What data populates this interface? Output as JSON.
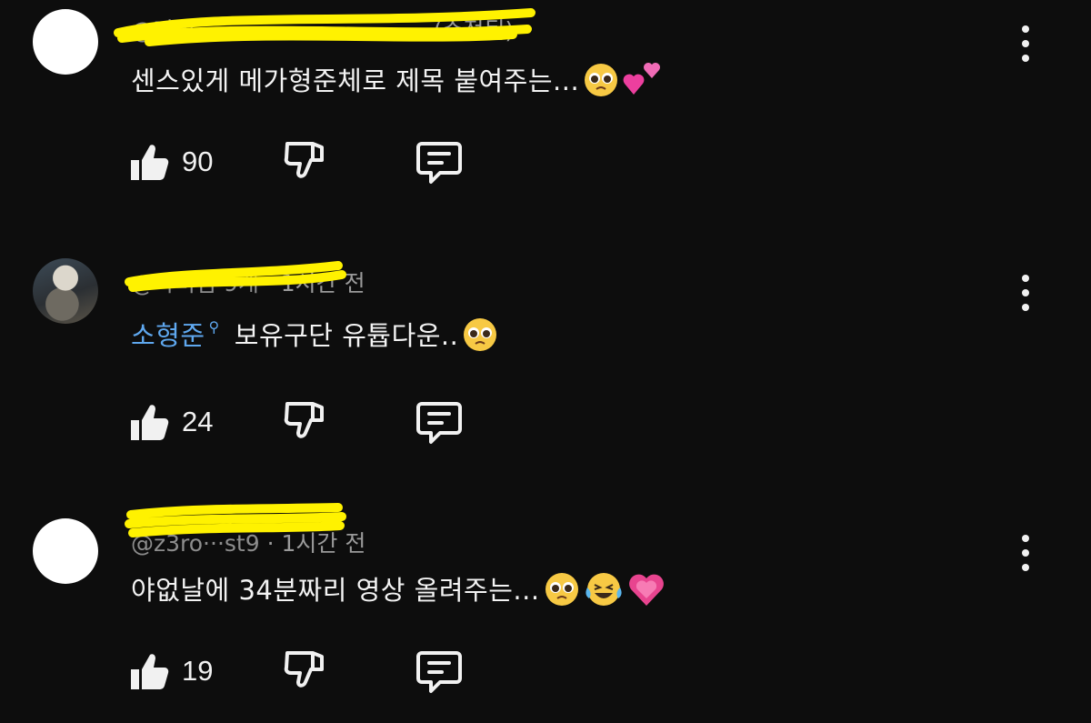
{
  "comments": [
    {
      "handle": "@자리···",
      "time": "(수정됨)",
      "text": "센스있게 메가형준체로 제목 붙여주는...",
      "emojis": [
        "pleading-face-emoji",
        "two-hearts-emoji"
      ],
      "likes": "90"
    },
    {
      "handle": "@라비킴·9개",
      "time": "1시간 전",
      "mention": "소형준",
      "text": "보유구단 유튭다운..",
      "emojis": [
        "pleading-face-emoji"
      ],
      "likes": "24"
    },
    {
      "handle": "@z3ro···st9",
      "time": "1시간 전",
      "text": "야없날에 34분짜리 영상 올려주는...",
      "emojis": [
        "pleading-face-emoji",
        "joy-face-emoji",
        "growing-heart-emoji"
      ],
      "likes": "19"
    }
  ],
  "icons": {
    "like": "thumbs-up-icon",
    "dislike": "thumbs-down-icon",
    "reply": "reply-icon",
    "more": "more-vert-icon",
    "mention": "search-icon"
  },
  "colors": {
    "background": "#0d0d0d",
    "text": "#f1f1f1",
    "meta": "#9a9a9a",
    "mention": "#5fa8ef",
    "highlight": "#fff200"
  }
}
